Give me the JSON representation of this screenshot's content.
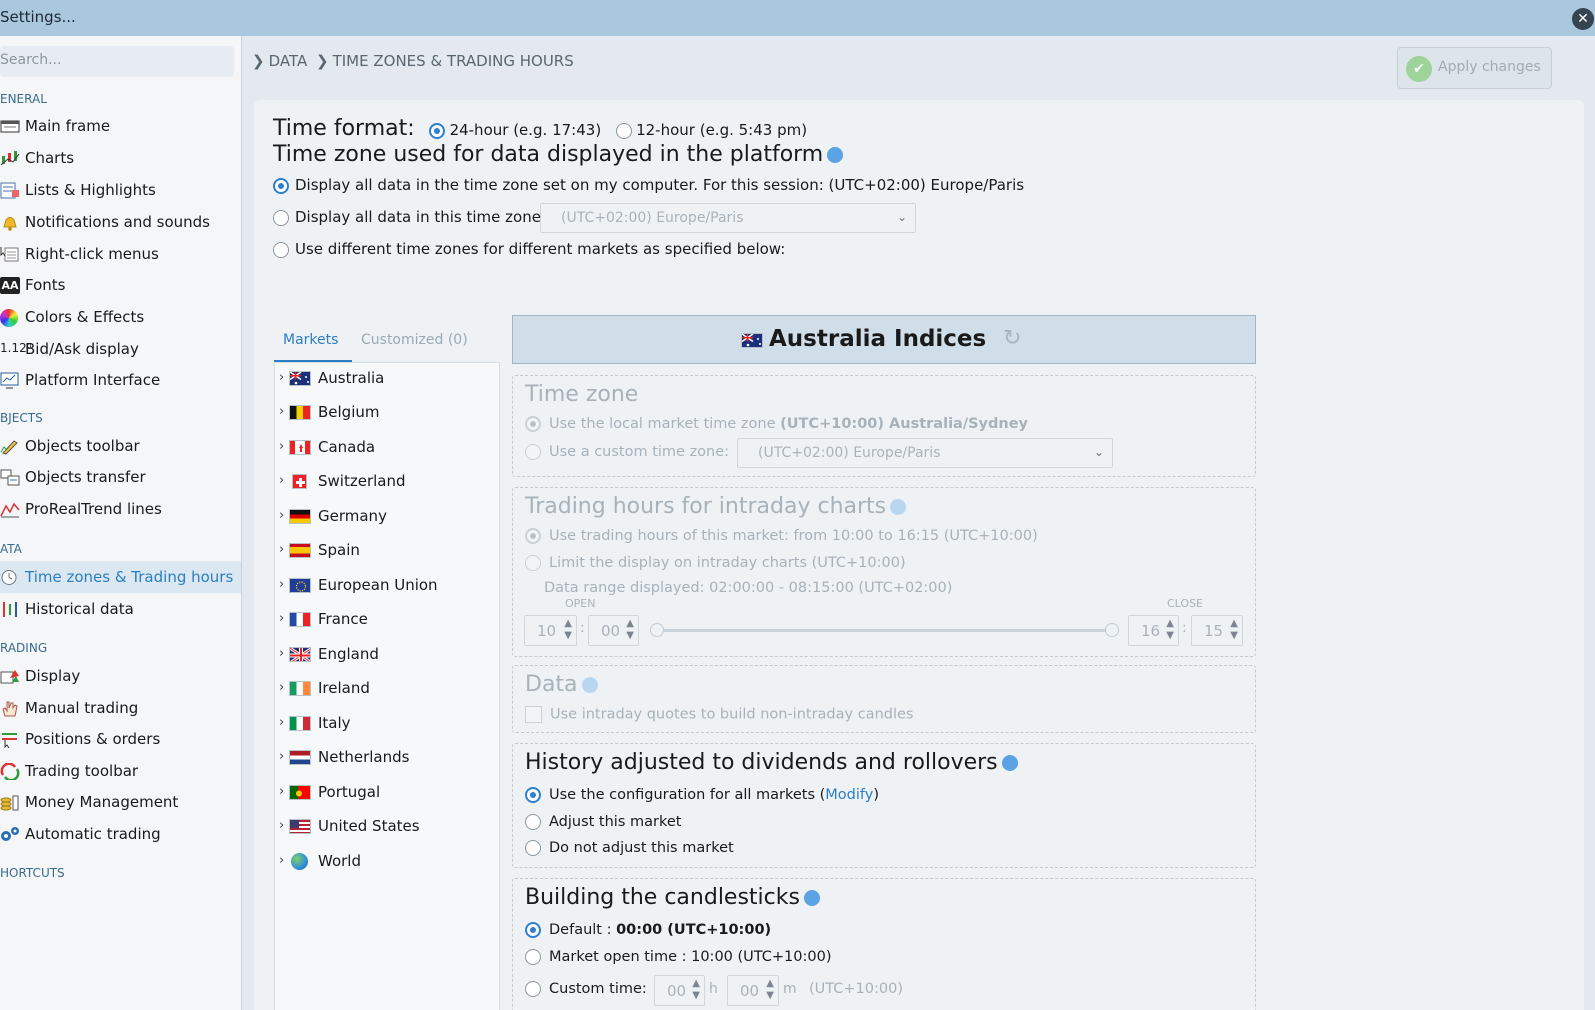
{
  "window": {
    "title": "Settings...",
    "close_glyph": "✕"
  },
  "sidebar": {
    "search_placeholder": "Search...",
    "sections": [
      {
        "title": "ENERAL",
        "items": [
          {
            "label": "Main frame",
            "icon": "main-frame-icon"
          },
          {
            "label": "Charts",
            "icon": "charts-icon"
          },
          {
            "label": "Lists & Highlights",
            "icon": "lists-icon"
          },
          {
            "label": "Notifications and sounds",
            "icon": "bell-icon"
          },
          {
            "label": "Right-click menus",
            "icon": "menu-icon"
          },
          {
            "label": "Fonts",
            "icon": "fonts-icon",
            "glyph": "AA"
          },
          {
            "label": "Colors & Effects",
            "icon": "color-wheel-icon"
          },
          {
            "label": "Bid/Ask display",
            "icon": "bid-ask-icon",
            "glyph": "1.12⁰"
          },
          {
            "label": "Platform Interface",
            "icon": "monitor-icon"
          }
        ]
      },
      {
        "title": "BJECTS",
        "items": [
          {
            "label": "Objects toolbar",
            "icon": "pencil-icon"
          },
          {
            "label": "Objects transfer",
            "icon": "transfer-icon"
          },
          {
            "label": "ProRealTrend lines",
            "icon": "trend-lines-icon"
          }
        ]
      },
      {
        "title": "ATA",
        "items": [
          {
            "label": "Time zones & Trading hours",
            "icon": "clock-icon",
            "active": true
          },
          {
            "label": "Historical data",
            "icon": "historical-data-icon"
          }
        ]
      },
      {
        "title": "RADING",
        "items": [
          {
            "label": "Display",
            "icon": "display-icon"
          },
          {
            "label": "Manual trading",
            "icon": "hand-icon"
          },
          {
            "label": "Positions & orders",
            "icon": "positions-icon"
          },
          {
            "label": "Trading toolbar",
            "icon": "trading-toolbar-icon"
          },
          {
            "label": "Money Management",
            "icon": "coins-icon"
          },
          {
            "label": "Automatic trading",
            "icon": "gears-icon"
          }
        ]
      },
      {
        "title": "HORTCUTS",
        "items": []
      }
    ]
  },
  "breadcrumb": [
    "DATA",
    "TIME ZONES & TRADING HOURS"
  ],
  "apply_button": {
    "label": "Apply changes"
  },
  "time_format": {
    "label": "Time format:",
    "options": [
      "24-hour (e.g. 17:43)",
      "12-hour (e.g. 5:43 pm)"
    ],
    "selected": 0
  },
  "timezone_section": {
    "title": "Time zone used for data displayed in the platform",
    "options": [
      "Display all data in the time zone set on my computer. For this session: (UTC+02:00) Europe/Paris",
      "Display all data in this time zone:",
      "Use different time zones for different markets as specified below:"
    ],
    "selected": 0,
    "select_value": "(UTC+02:00) Europe/Paris"
  },
  "market_tabs": [
    "Markets",
    "Customized (0)"
  ],
  "markets": [
    {
      "name": "Australia",
      "flag": "au"
    },
    {
      "name": "Belgium",
      "flag": "be"
    },
    {
      "name": "Canada",
      "flag": "ca"
    },
    {
      "name": "Switzerland",
      "flag": "ch"
    },
    {
      "name": "Germany",
      "flag": "de"
    },
    {
      "name": "Spain",
      "flag": "es"
    },
    {
      "name": "European Union",
      "flag": "eu"
    },
    {
      "name": "France",
      "flag": "fr"
    },
    {
      "name": "England",
      "flag": "gb"
    },
    {
      "name": "Ireland",
      "flag": "ie"
    },
    {
      "name": "Italy",
      "flag": "it"
    },
    {
      "name": "Netherlands",
      "flag": "nl"
    },
    {
      "name": "Portugal",
      "flag": "pt"
    },
    {
      "name": "United States",
      "flag": "us"
    },
    {
      "name": "World",
      "flag": "world"
    }
  ],
  "detail": {
    "title": "Australia Indices",
    "time_zone": {
      "title": "Time zone",
      "opt_local_prefix": "Use the local market time zone ",
      "opt_local_bold": "(UTC+10:00) Australia/Sydney",
      "opt_custom": "Use a custom time zone:",
      "custom_value": "(UTC+02:00) Europe/Paris"
    },
    "trading_hours": {
      "title": "Trading hours for intraday charts",
      "opt1": "Use trading hours of this market: from 10:00 to 16:15 (UTC+10:00)",
      "opt2": "Limit the display on intraday charts (UTC+10:00)",
      "range": "Data range displayed: 02:00:00 - 08:15:00 (UTC+02:00)",
      "open_label": "OPEN",
      "close_label": "CLOSE",
      "open_h": "10",
      "open_m": "00",
      "close_h": "16",
      "close_m": "15",
      "sep": ":"
    },
    "data": {
      "title": "Data",
      "checkbox": "Use intraday quotes to build non-intraday candles"
    },
    "history": {
      "title": "History adjusted to dividends and rollovers",
      "opt1_prefix": "Use the configuration for all markets (",
      "opt1_link": "Modify",
      "opt1_suffix": ")",
      "opt2": "Adjust this market",
      "opt3": "Do not adjust this market"
    },
    "candles": {
      "title": "Building the candlesticks",
      "opt1_prefix": "Default : ",
      "opt1_bold": "00:00 (UTC+10:00)",
      "opt2": "Market open time : 10:00 (UTC+10:00)",
      "opt3": "Custom time:",
      "h_value": "00",
      "h_unit": "h",
      "m_value": "00",
      "m_unit": "m",
      "tz": "(UTC+10:00)"
    }
  },
  "colors": {
    "accent": "#2a7fc4",
    "titlebar": "#a9c7dd"
  }
}
